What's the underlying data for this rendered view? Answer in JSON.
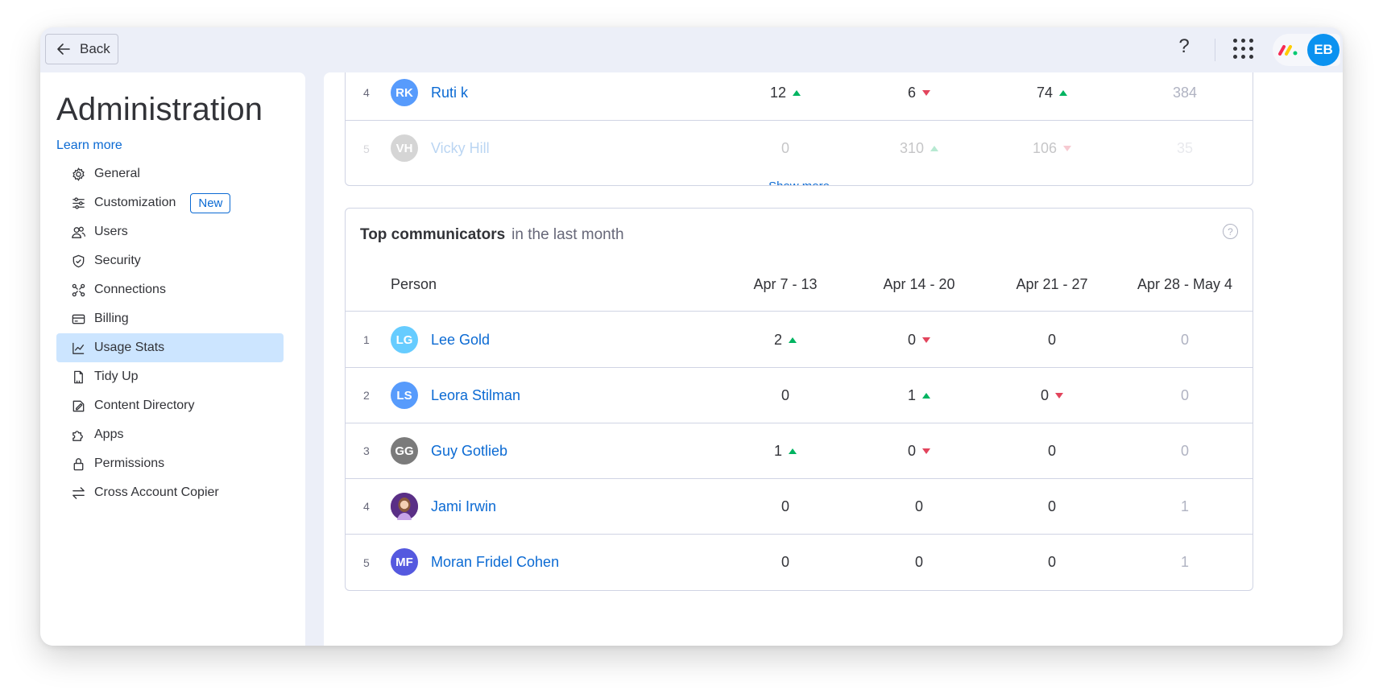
{
  "topbar": {
    "back_label": "Back",
    "help_label": "?",
    "user_initials": "EB",
    "user_avatar_color": "#0b92f0"
  },
  "sidebar": {
    "title": "Administration",
    "learn_more": "Learn more",
    "items": [
      {
        "label": "General",
        "icon": "gear-icon"
      },
      {
        "label": "Customization",
        "icon": "sliders-icon",
        "badge": "New"
      },
      {
        "label": "Users",
        "icon": "users-icon"
      },
      {
        "label": "Security",
        "icon": "shield-icon"
      },
      {
        "label": "Connections",
        "icon": "connections-icon"
      },
      {
        "label": "Billing",
        "icon": "credit-card-icon"
      },
      {
        "label": "Usage Stats",
        "icon": "chart-icon",
        "active": true
      },
      {
        "label": "Tidy Up",
        "icon": "broom-icon"
      },
      {
        "label": "Content Directory",
        "icon": "directory-icon"
      },
      {
        "label": "Apps",
        "icon": "puzzle-icon"
      },
      {
        "label": "Permissions",
        "icon": "lock-icon"
      },
      {
        "label": "Cross Account Copier",
        "icon": "swap-arrows-icon"
      }
    ]
  },
  "prev_card": {
    "rows": [
      {
        "rank": "4",
        "initials": "RK",
        "name": "Ruti k",
        "color": "#579bfc",
        "values": [
          "12",
          "6",
          "74",
          "384"
        ],
        "trends": [
          "up",
          "down",
          "up",
          ""
        ]
      },
      {
        "rank": "5",
        "initials": "VH",
        "name": "Vicky Hill",
        "color": "#6b6b6b",
        "values": [
          "0",
          "310",
          "106",
          "35"
        ],
        "trends": [
          "",
          "up",
          "down",
          ""
        ]
      }
    ],
    "show_more": "Show more"
  },
  "communicators": {
    "title": "Top communicators",
    "subtitle": "in the last month",
    "help_label": "?",
    "columns": [
      "Person",
      "Apr 7 - 13",
      "Apr 14 - 20",
      "Apr 21 - 27",
      "Apr 28 - May 4"
    ],
    "rows": [
      {
        "rank": "1",
        "initials": "LG",
        "name": "Lee Gold",
        "color": "#66ccff",
        "values": [
          "2",
          "0",
          "0",
          "0"
        ],
        "trends": [
          "up",
          "down",
          "",
          ""
        ]
      },
      {
        "rank": "2",
        "initials": "LS",
        "name": "Leora Stilman",
        "color": "#579bfc",
        "values": [
          "0",
          "1",
          "0",
          "0"
        ],
        "trends": [
          "",
          "up",
          "down",
          ""
        ]
      },
      {
        "rank": "3",
        "initials": "GG",
        "name": "Guy Gotlieb",
        "color": "#7b7b7b",
        "values": [
          "1",
          "0",
          "0",
          "0"
        ],
        "trends": [
          "up",
          "down",
          "",
          ""
        ]
      },
      {
        "rank": "4",
        "initials": "",
        "name": "Jami Irwin",
        "color": "#7a4aa8",
        "photo": true,
        "values": [
          "0",
          "0",
          "0",
          "1"
        ],
        "trends": [
          "",
          "",
          "",
          ""
        ]
      },
      {
        "rank": "5",
        "initials": "MF",
        "name": "Moran Fridel Cohen",
        "color": "#5559df",
        "values": [
          "0",
          "0",
          "0",
          "1"
        ],
        "trends": [
          "",
          "",
          "",
          ""
        ]
      }
    ]
  }
}
